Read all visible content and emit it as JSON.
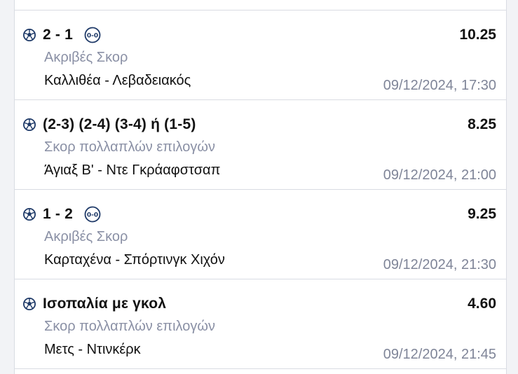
{
  "bets": [
    {
      "selection": "2 - 1",
      "has_zero_icon": true,
      "odds": "10.25",
      "market": "Ακριβές Σκορ",
      "event": "Καλλιθέα - Λεβαδειακός",
      "datetime": "09/12/2024, 17:30"
    },
    {
      "selection": "(2-3) (2-4) (3-4) ή (1-5)",
      "has_zero_icon": false,
      "odds": "8.25",
      "market": "Σκορ πολλαπλών επιλογών",
      "event": "Άγιαξ Β' - Ντε Γκράαφστσαπ",
      "datetime": "09/12/2024, 21:00"
    },
    {
      "selection": "1 - 2",
      "has_zero_icon": true,
      "odds": "9.25",
      "market": "Ακριβές Σκορ",
      "event": "Καρταχένα - Σπόρτινγκ Χιχόν",
      "datetime": "09/12/2024, 21:30"
    },
    {
      "selection": "Ισοπαλία με γκολ",
      "has_zero_icon": false,
      "odds": "4.60",
      "market": "Σκορ πολλαπλών επιλογών",
      "event": "Μετς - Ντινκέρκ",
      "datetime": "09/12/2024, 21:45"
    }
  ],
  "icons": {
    "sport": "football-icon",
    "score_badge": "zero-zero-icon"
  },
  "colors": {
    "icon_blue": "#1f3a68",
    "muted_text": "#8a90a5",
    "divider": "#d9dce3"
  }
}
